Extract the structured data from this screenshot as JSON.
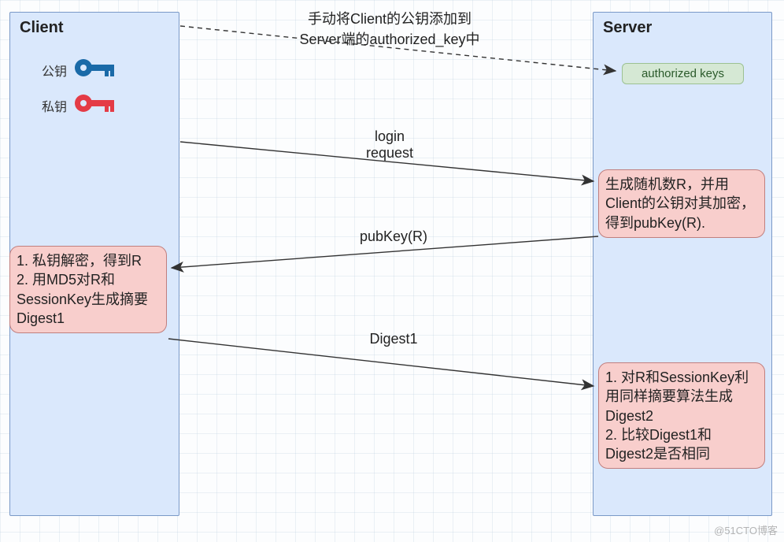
{
  "client": {
    "title": "Client",
    "pub_label": "公钥",
    "priv_label": "私钥",
    "step_box": "1. 私钥解密，得到R\n2. 用MD5对R和SessionKey生成摘要Digest1"
  },
  "server": {
    "title": "Server",
    "auth_keys": "authorized keys",
    "step_box_1": "生成随机数R，并用Client的公钥对其加密，得到pubKey(R).",
    "step_box_2": "1. 对R和SessionKey利用同样摘要算法生成Digest2\n2. 比较Digest1和Digest2是否相同"
  },
  "arrows": {
    "manual_add": "手动将Client的公钥添加到\nServer端的authorized_key中",
    "login": "login\nrequest",
    "pubkey": "pubKey(R)",
    "digest": "Digest1"
  },
  "watermark": "@51CTO博客"
}
